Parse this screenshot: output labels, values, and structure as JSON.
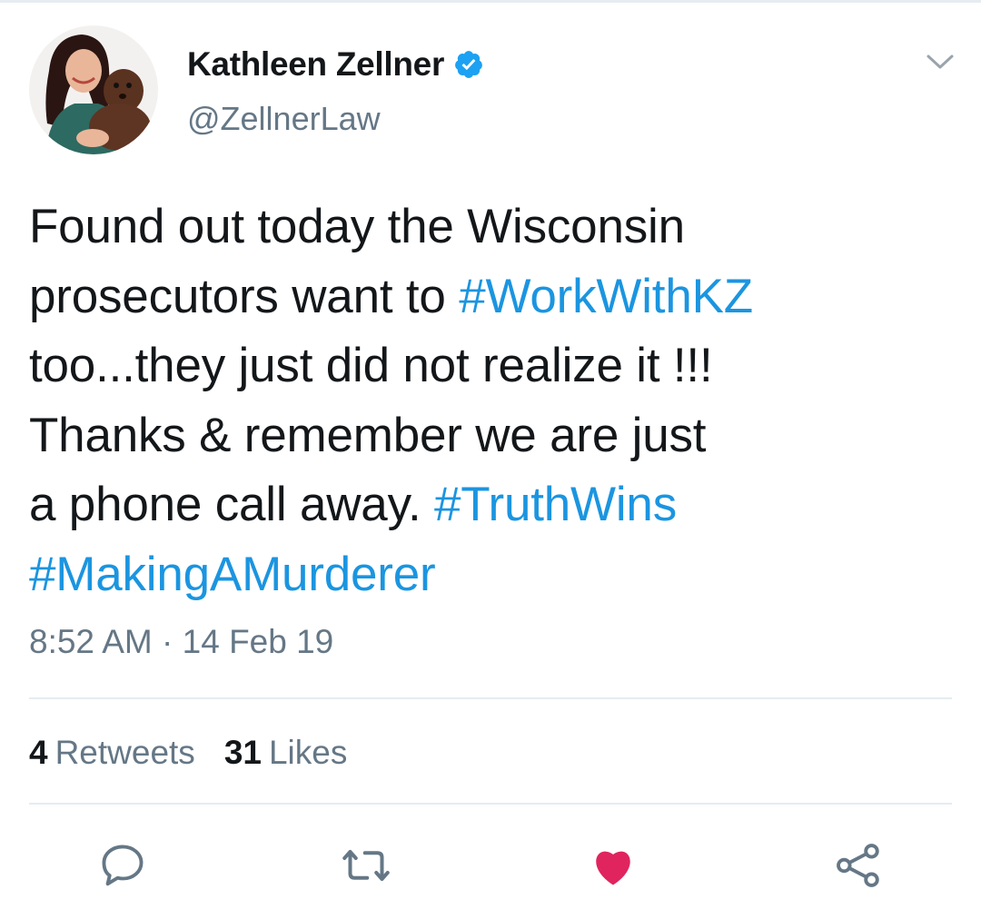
{
  "author": {
    "display_name": "Kathleen Zellner",
    "handle": "@ZellnerLaw",
    "verified": true
  },
  "tweet": {
    "lines": [
      [
        {
          "text": "Found out today the Wisconsin",
          "hashtag": false
        }
      ],
      [
        {
          "text": "prosecutors want to ",
          "hashtag": false
        },
        {
          "text": "#WorkWithKZ",
          "hashtag": true
        }
      ],
      [
        {
          "text": "too...they just did not realize it !!!",
          "hashtag": false
        }
      ],
      [
        {
          "text": "Thanks & remember we are just",
          "hashtag": false
        }
      ],
      [
        {
          "text": "a phone call away. ",
          "hashtag": false
        },
        {
          "text": "#TruthWins",
          "hashtag": true
        }
      ],
      [
        {
          "text": "#MakingAMurderer",
          "hashtag": true
        }
      ]
    ],
    "timestamp": "8:52 AM · 14 Feb 19"
  },
  "stats": {
    "retweets_count": "4",
    "retweets_label": "Retweets",
    "likes_count": "31",
    "likes_label": "Likes"
  },
  "actions": {
    "reply_icon": "reply-icon",
    "retweet_icon": "retweet-icon",
    "like_icon": "heart-icon",
    "like_state": "liked",
    "share_icon": "share-icon"
  },
  "colors": {
    "hashtag": "#1b95e0",
    "secondary_text": "#657786",
    "primary_text": "#14171a",
    "verified_badge": "#1da1f2",
    "liked_heart": "#e0245e",
    "divider": "#e6ecf0"
  }
}
